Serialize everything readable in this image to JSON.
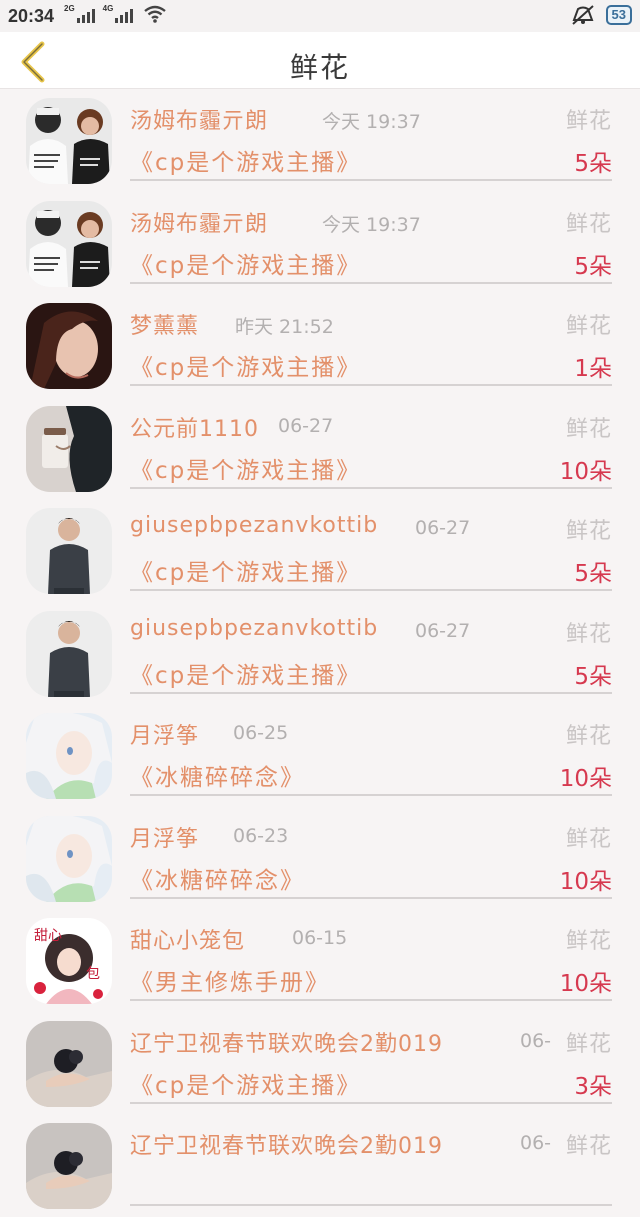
{
  "status_bar": {
    "time": "20:34",
    "net1": "2G",
    "net2": "4G",
    "battery": "53"
  },
  "header": {
    "back_icon": "chevron-left-icon",
    "title": "鲜花"
  },
  "colors": {
    "accent": "#e3906a",
    "count": "#d6394f",
    "back": "#e7c54a",
    "muted": "#b3b0b0"
  },
  "gifts": [
    {
      "name": "汤姆布霾亓朗",
      "time": "今天 19:37",
      "tag": "鲜花",
      "title": "《cp是个游戏主播》",
      "count": "5朵",
      "avatar": "couple-avatar"
    },
    {
      "name": "汤姆布霾亓朗",
      "time": "今天 19:37",
      "tag": "鲜花",
      "title": "《cp是个游戏主播》",
      "count": "5朵",
      "avatar": "couple-avatar"
    },
    {
      "name": "梦薰薰",
      "time": "昨天 21:52",
      "tag": "鲜花",
      "title": "《cp是个游戏主播》",
      "count": "1朵",
      "avatar": "portrait-avatar"
    },
    {
      "name": "公元前1110",
      "time": "06-27",
      "tag": "鲜花",
      "title": "《cp是个游戏主播》",
      "count": "10朵",
      "avatar": "coffee-avatar"
    },
    {
      "name": "giusepbpezanvkottib",
      "time": "06-27",
      "tag": "鲜花",
      "title": "《cp是个游戏主播》",
      "count": "5朵",
      "avatar": "man-sweater-avatar"
    },
    {
      "name": "giusepbpezanvkottib",
      "time": "06-27",
      "tag": "鲜花",
      "title": "《cp是个游戏主播》",
      "count": "5朵",
      "avatar": "man-sweater-avatar"
    },
    {
      "name": "月浮筝",
      "time": "06-25",
      "tag": "鲜花",
      "title": "《冰糖碎碎念》",
      "count": "10朵",
      "avatar": "anime-girl-avatar"
    },
    {
      "name": "月浮筝",
      "time": "06-23",
      "tag": "鲜花",
      "title": "《冰糖碎碎念》",
      "count": "10朵",
      "avatar": "anime-girl-avatar"
    },
    {
      "name": "甜心小笼包",
      "time": "06-15",
      "tag": "鲜花",
      "title": "《男主修炼手册》",
      "count": "10朵",
      "avatar": "sweet-bun-avatar"
    },
    {
      "name": "辽宁卫视春节联欢晚会2勤019",
      "time": "06-",
      "tag": "鲜花",
      "title": "《cp是个游戏主播》",
      "count": "3朵",
      "avatar": "hand-avatar"
    },
    {
      "name": "辽宁卫视春节联欢晚会2勤019",
      "time": "06-",
      "tag": "鲜花",
      "title": "",
      "count": "",
      "avatar": "hand-avatar"
    }
  ]
}
